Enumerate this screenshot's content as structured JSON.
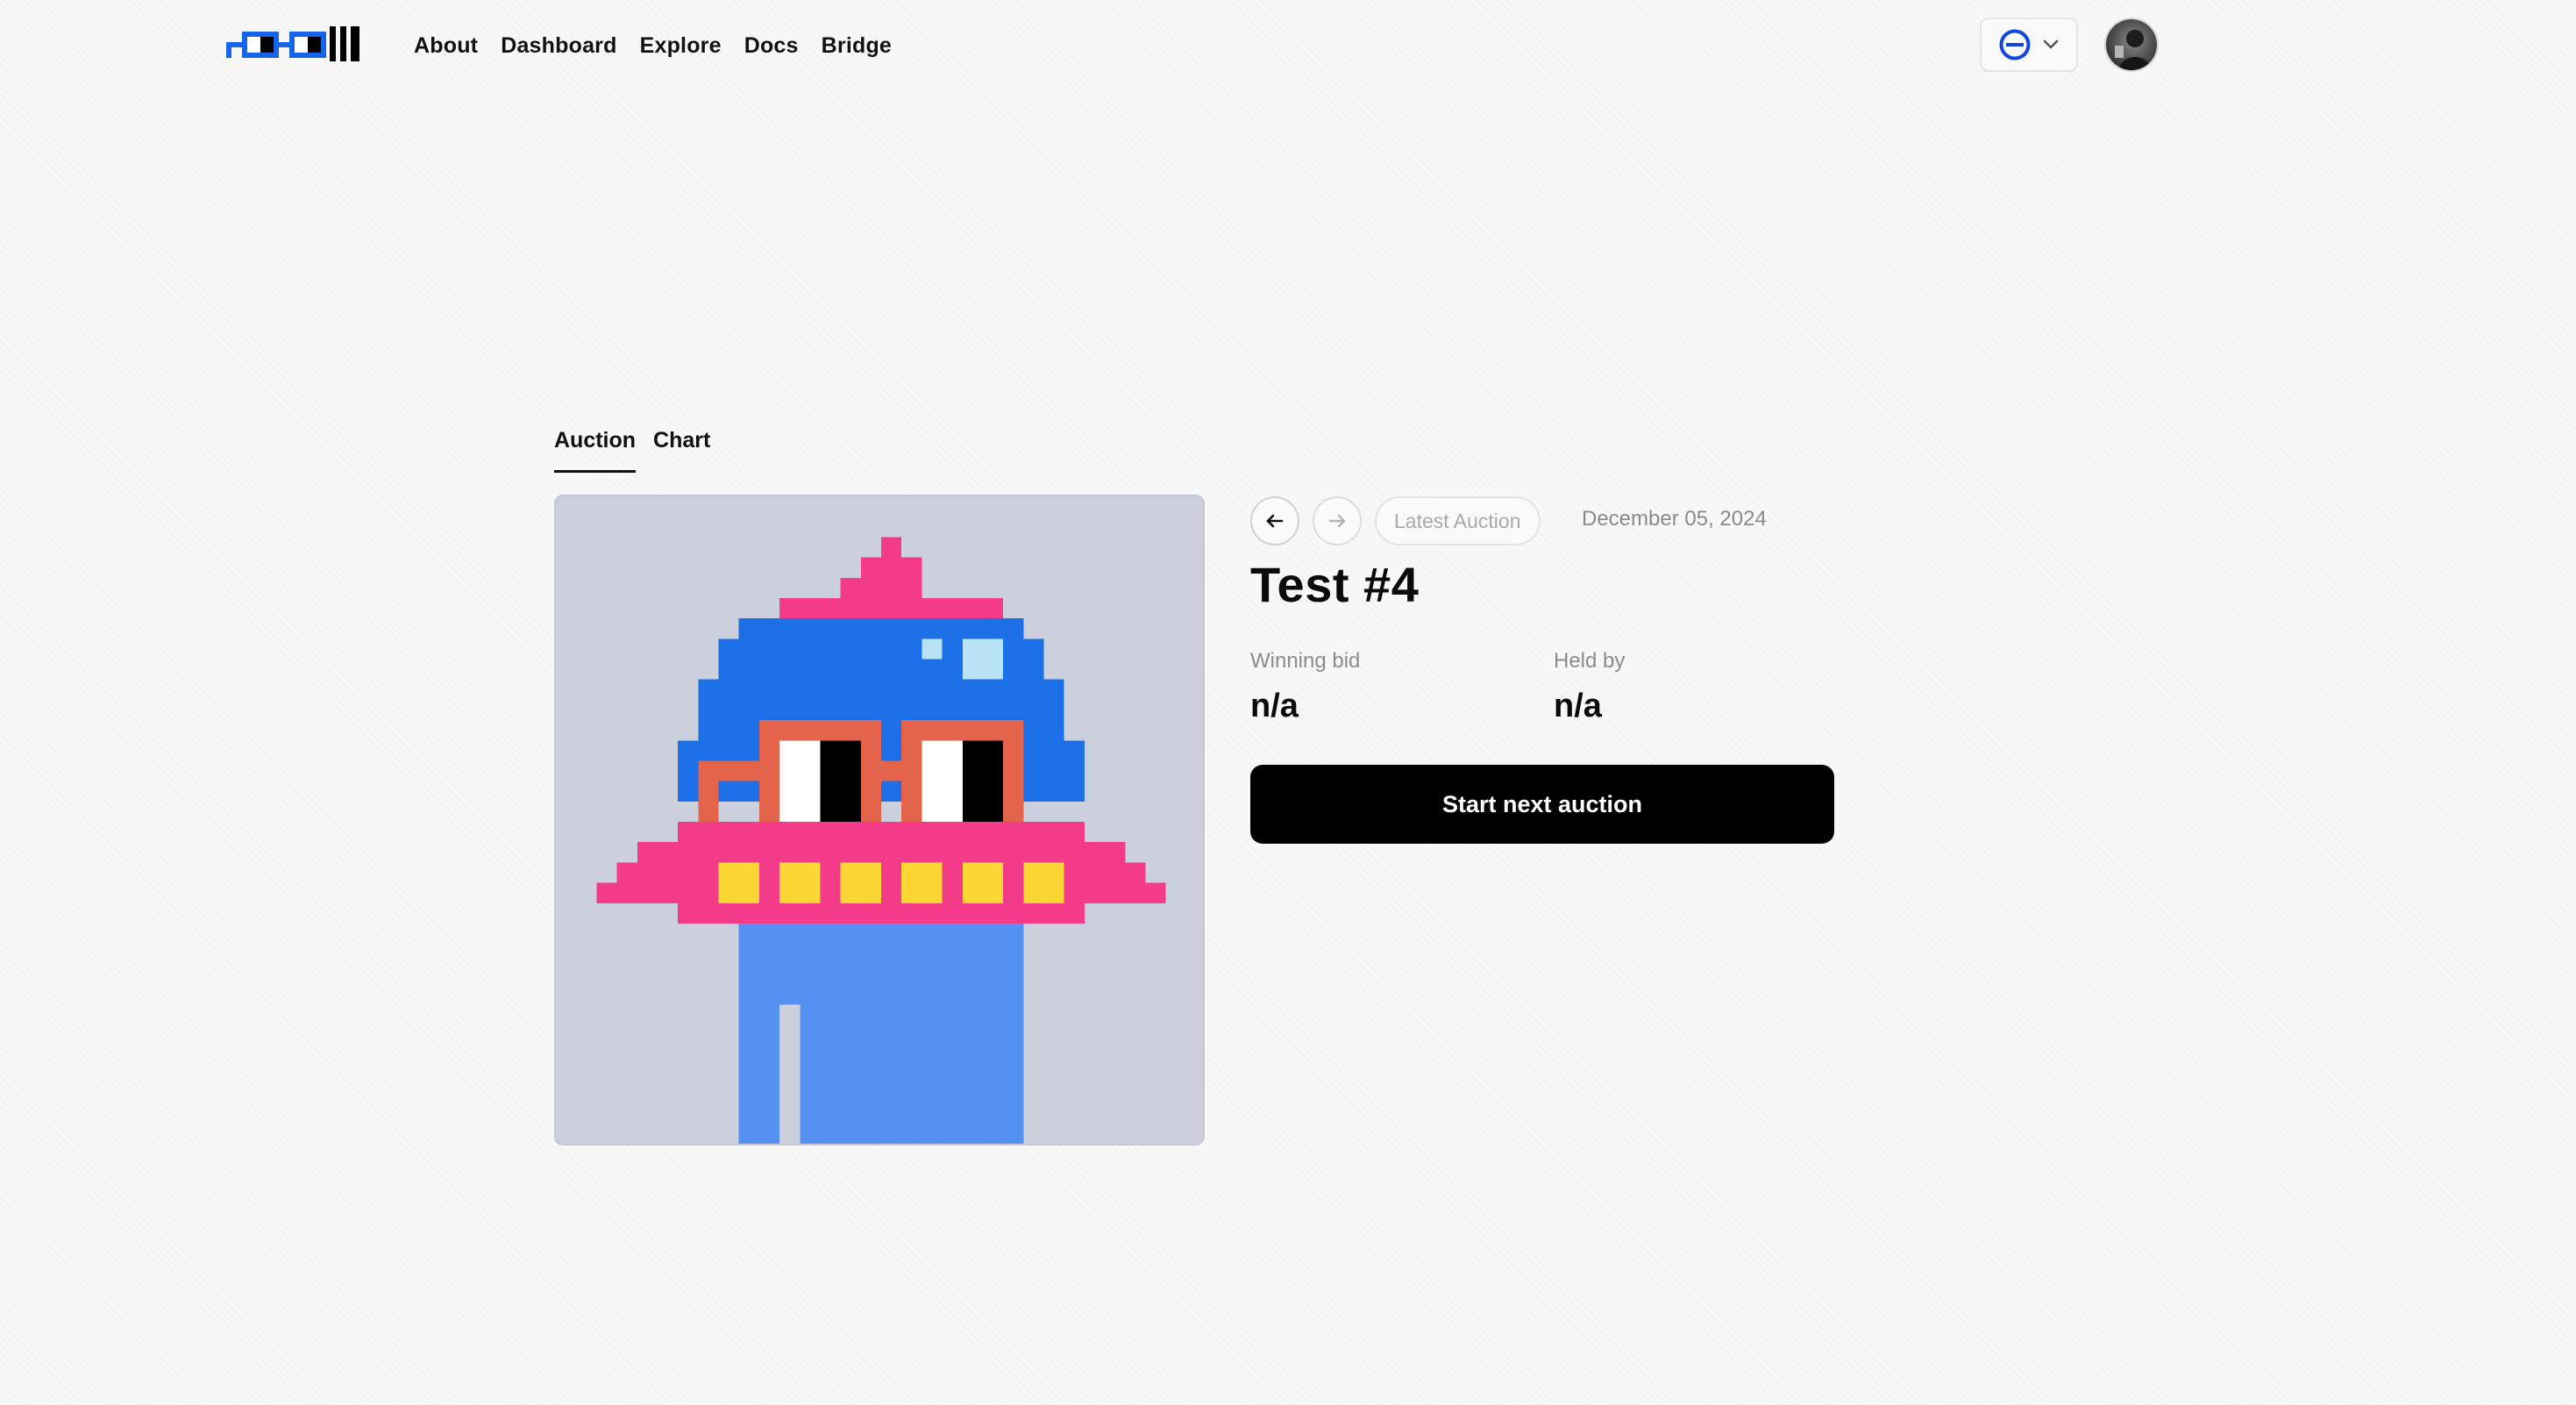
{
  "header": {
    "logo_icon": "logo-icon",
    "nav": [
      {
        "label": "About"
      },
      {
        "label": "Dashboard"
      },
      {
        "label": "Explore"
      },
      {
        "label": "Docs"
      },
      {
        "label": "Bridge"
      }
    ],
    "chain_icon": "chain-icon",
    "avatar_icon": "avatar"
  },
  "tabs": [
    {
      "label": "Auction",
      "active": true
    },
    {
      "label": "Chart",
      "active": false
    }
  ],
  "auction": {
    "prev_icon": "arrow-left-icon",
    "next_icon": "arrow-right-icon",
    "latest_label": "Latest Auction",
    "date": "December 05, 2024",
    "title": "Test #4",
    "winning_bid_label": "Winning bid",
    "winning_bid_value": "n/a",
    "held_by_label": "Held by",
    "held_by_value": "n/a",
    "start_button_label": "Start next auction"
  },
  "colors": {
    "page_bg": "#f8f8f8",
    "art_bg": "#cbd0dc",
    "brand_blue": "#1665e8",
    "button_bg": "#000000"
  }
}
